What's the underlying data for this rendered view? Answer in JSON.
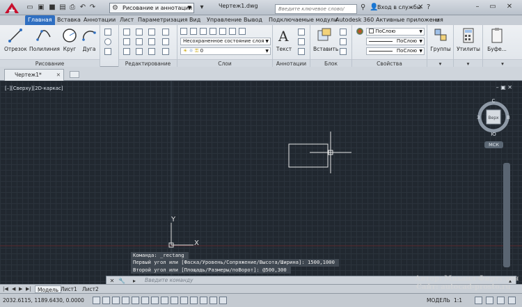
{
  "titlebar": {
    "app_logo": "A",
    "workspace": "Рисование и аннотации",
    "document_title": "Чертеж1.dwg",
    "search_placeholder": "Введите ключевое слово/фразу",
    "signin": "Вход в службы"
  },
  "ribbon_tabs": [
    "Главная",
    "Вставка",
    "Аннотации",
    "Лист",
    "Параметризация",
    "Вид",
    "Управление",
    "Вывод",
    "Подключаемые модули",
    "Autodesk 360",
    "Активные приложения"
  ],
  "active_tab": "Главная",
  "ribbon": {
    "draw": {
      "title": "Рисование",
      "line": "Отрезок",
      "polyline": "Полилиния",
      "circle": "Круг",
      "arc": "Дуга"
    },
    "modify": {
      "title": "Редактирование"
    },
    "layers": {
      "title": "Слои",
      "layer_state": "Несохраненное состояние слоя",
      "current_layer": "0"
    },
    "annotation": {
      "title": "Аннотации",
      "text": "Текст"
    },
    "block": {
      "title": "Блок",
      "insert": "Вставить"
    },
    "properties": {
      "title": "Свойства",
      "color": "ПоСлою",
      "linetype": "ПоСлою",
      "lineweight": "ПоСлою"
    },
    "groups": {
      "label": "Группы"
    },
    "utilities": {
      "label": "Утилиты"
    },
    "clipboard": {
      "label": "Буфе..."
    }
  },
  "document_tab": "Чертеж1*",
  "viewport": {
    "label": "[–][Сверху][2D-каркас]",
    "viewcube": {
      "north": "С",
      "south": "Ю",
      "west": "З",
      "east": "В",
      "face": "Верх"
    },
    "ucs_badge": "МСК",
    "ucs_y": "Y",
    "ucs_x": "X"
  },
  "command_history": [
    "Команда: _rectang",
    "Первый угол или [Фаска/Уровень/Сопряжение/Высота/Ширина]: 1500,1000",
    "Второй угол или [Площадь/Размеры/поВорот]: @500,300"
  ],
  "command_placeholder": "Введите команду",
  "layout_tabs": [
    "Модель",
    "Лист1",
    "Лист2"
  ],
  "active_layout": "Модель",
  "status": {
    "coordinates": "2032.6115, 1189.6430, 0.0000",
    "mode": "МОДЕЛЬ",
    "scale": "1:1"
  },
  "watermark": {
    "author": "Автор: Михаил Фиртулин",
    "site": "Сайт:    autocad-prosto.ru"
  },
  "colors": {
    "accent": "#2f6fc1",
    "canvas": "#212830",
    "logo": "#c8102e"
  }
}
